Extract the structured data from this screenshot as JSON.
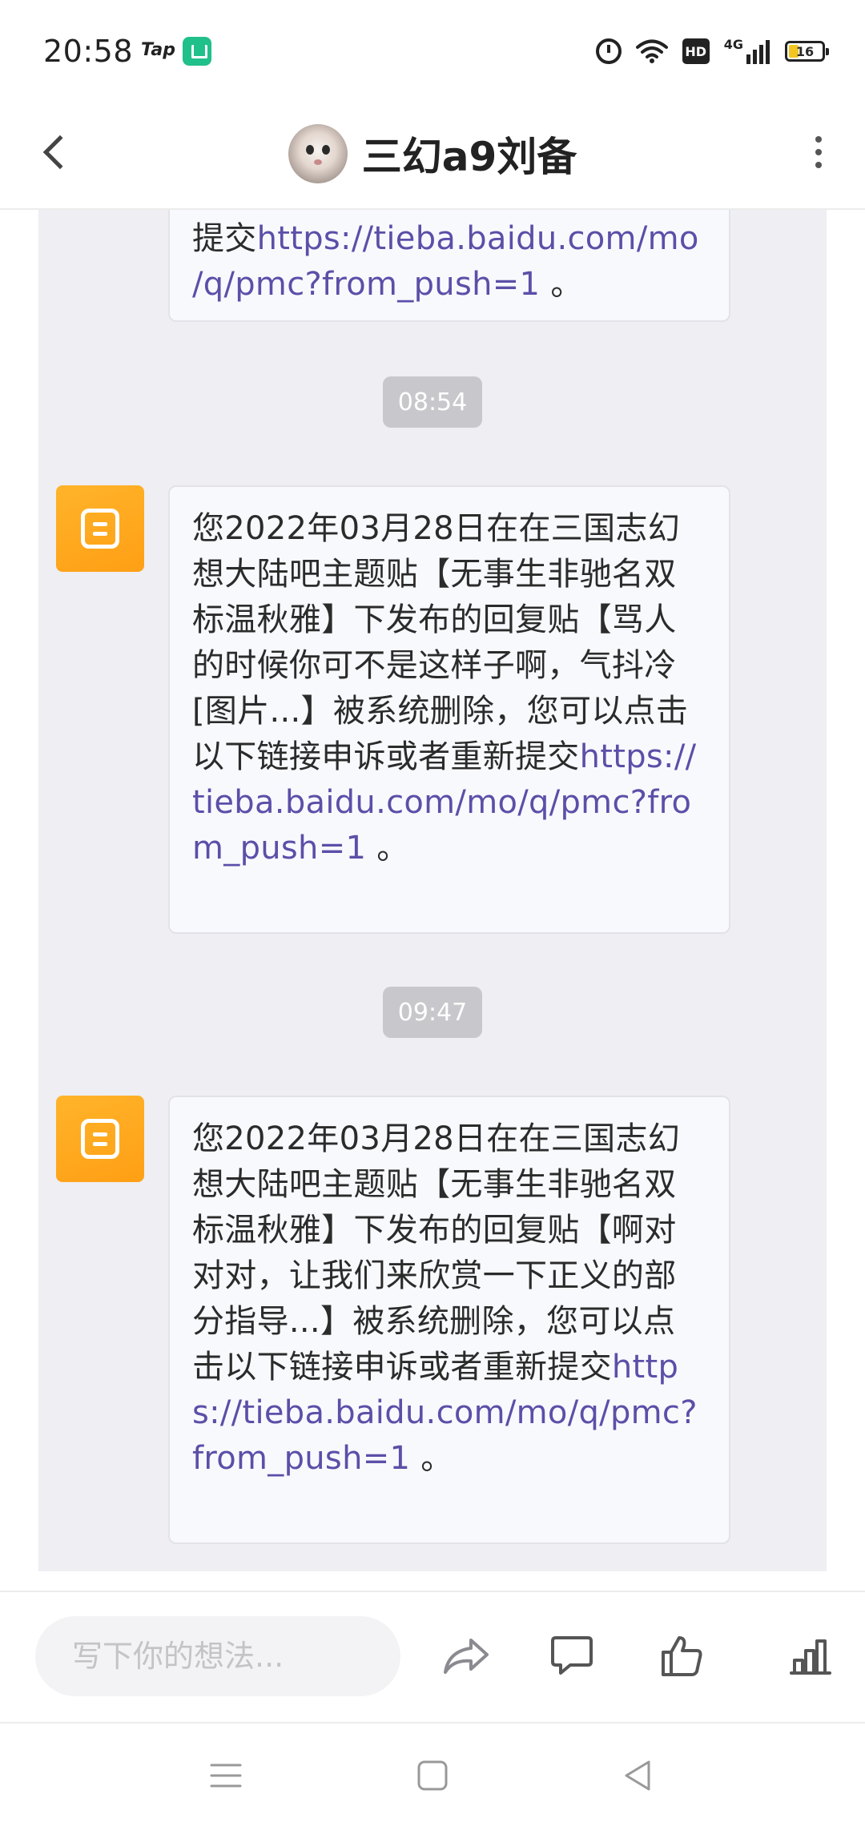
{
  "status_bar": {
    "time": "20:58",
    "tap_label": "Tap",
    "hd_label": "HD",
    "network_label": "4G",
    "battery_level": "16"
  },
  "header": {
    "title": "三幻a9刘备"
  },
  "messages": {
    "first_partial": {
      "line1_text": "提交",
      "line1_link": "https://tieba.baidu.com/mo",
      "line2_link": "/q/pmc?from_push=1",
      "line2_end": " 。"
    },
    "time1": "08:54",
    "msg1": {
      "text": "您2022年03月28日在在三国志幻想大陆吧主题贴【无事生非驰名双标温秋雅】下发布的回复贴【骂人的时候你可不是这样子啊，气抖冷[图片...】被系统删除，您可以点击以下链接申诉或者重新提交",
      "link": "https://tieba.baidu.com/mo/q/pmc?from_push=1",
      "end": " 。"
    },
    "time2": "09:47",
    "msg2": {
      "text": "您2022年03月28日在在三国志幻想大陆吧主题贴【无事生非驰名双标温秋雅】下发布的回复贴【啊对对对，让我们来欣赏一下正义的部分指导...】被系统删除，您可以点击以下链接申诉或者重新提交",
      "link": "https://tieba.baidu.com/mo/q/pmc?from_push=1",
      "end": " 。"
    }
  },
  "comment_bar": {
    "placeholder": "写下你的想法..."
  },
  "icons": {
    "back": "chevron-left-icon",
    "more": "more-vertical-icon",
    "system_message": "document-icon",
    "share": "share-icon",
    "comment": "comment-icon",
    "like": "thumbs-up-icon",
    "stats": "stats-icon",
    "nav_menu": "menu-icon",
    "nav_home": "home-icon",
    "nav_back": "back-triangle-icon"
  },
  "colors": {
    "link": "#5b4fa8",
    "system_icon": "#ffa51f",
    "chat_background": "#eeeef3",
    "time_pill": "#c8c8cc"
  }
}
